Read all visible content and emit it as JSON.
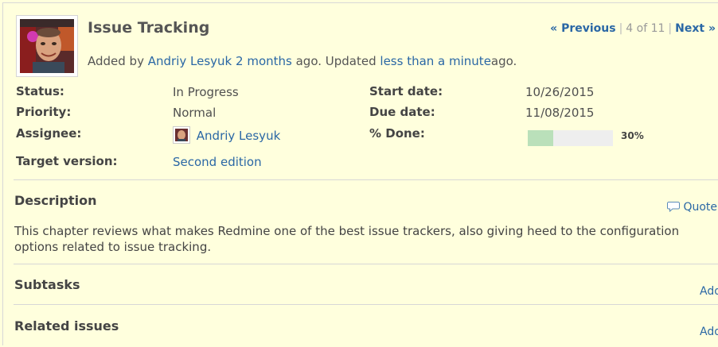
{
  "issue": {
    "title": "Issue Tracking",
    "added_prefix": "Added by",
    "author": "Andriy Lesyuk",
    "added_when": "2 months",
    "ago1": "ago. Updated",
    "updated_when": "less than a minute",
    "ago2": "ago."
  },
  "nav": {
    "previous": "« Previous",
    "position": "4 of 11",
    "next": "Next »"
  },
  "attributes": {
    "status_label": "Status:",
    "status": "In Progress",
    "priority_label": "Priority:",
    "priority": "Normal",
    "assignee_label": "Assignee:",
    "assignee": "Andriy Lesyuk",
    "target_label": "Target version:",
    "target": "Second edition",
    "start_label": "Start date:",
    "start": "10/26/2015",
    "due_label": "Due date:",
    "due": "11/08/2015",
    "done_label": "% Done:",
    "done_text": "30%",
    "done_fraction": 0.3
  },
  "description": {
    "heading": "Description",
    "quote": "Quote",
    "text": "This chapter reviews what makes Redmine one of the best issue trackers, also giving heed to the configuration options related to issue tracking."
  },
  "subtasks": {
    "heading": "Subtasks",
    "add": "Add"
  },
  "related": {
    "heading": "Related issues",
    "add": "Add"
  },
  "icons": {
    "quote": "speech-bubble-icon"
  },
  "colors": {
    "background": "#ffffdd",
    "link": "#2a67a5",
    "progress_done": "#bae0ba",
    "progress_todo": "#eeeeee"
  }
}
